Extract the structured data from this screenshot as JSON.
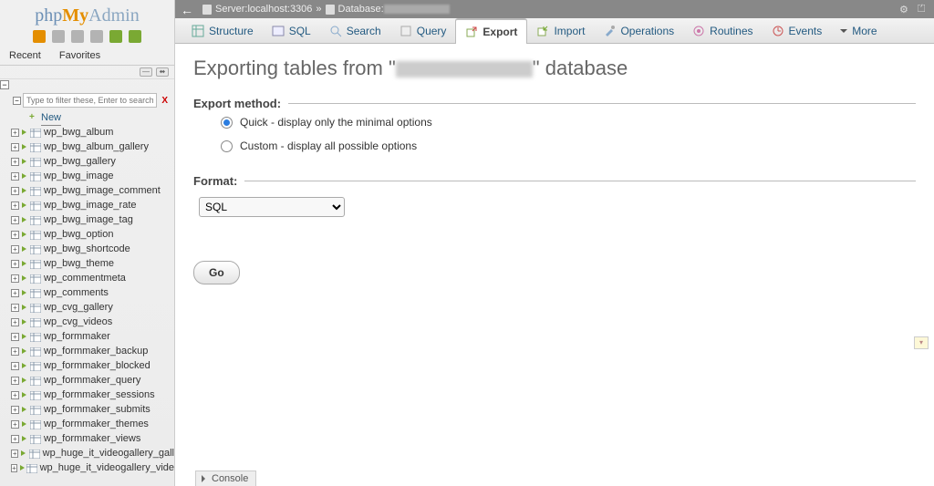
{
  "logo": {
    "p": "php",
    "my": "My",
    "admin": "Admin"
  },
  "navSmall": {
    "recent": "Recent",
    "favorites": "Favorites"
  },
  "filter": {
    "placeholder": "Type to filter these, Enter to search all",
    "clear": "X"
  },
  "tree": {
    "new": "New",
    "tables": [
      "wp_bwg_album",
      "wp_bwg_album_gallery",
      "wp_bwg_gallery",
      "wp_bwg_image",
      "wp_bwg_image_comment",
      "wp_bwg_image_rate",
      "wp_bwg_image_tag",
      "wp_bwg_option",
      "wp_bwg_shortcode",
      "wp_bwg_theme",
      "wp_commentmeta",
      "wp_comments",
      "wp_cvg_gallery",
      "wp_cvg_videos",
      "wp_formmaker",
      "wp_formmaker_backup",
      "wp_formmaker_blocked",
      "wp_formmaker_query",
      "wp_formmaker_sessions",
      "wp_formmaker_submits",
      "wp_formmaker_themes",
      "wp_formmaker_views",
      "wp_huge_it_videogallery_gall",
      "wp_huge_it_videogallery_vide"
    ]
  },
  "serverbar": {
    "server_prefix": "Server: ",
    "server": "localhost:3306",
    "sep": " » ",
    "db_prefix": "Database: "
  },
  "tabs": {
    "structure": "Structure",
    "sql": "SQL",
    "search": "Search",
    "query": "Query",
    "export": "Export",
    "import": "Import",
    "operations": "Operations",
    "routines": "Routines",
    "events": "Events",
    "more": "More"
  },
  "main": {
    "heading_pre": "Exporting tables from \"",
    "heading_post": "\" database",
    "method_legend": "Export method:",
    "method_quick": "Quick - display only the minimal options",
    "method_custom": "Custom - display all possible options",
    "format_legend": "Format:",
    "format_value": "SQL",
    "go": "Go"
  },
  "console": "Console"
}
